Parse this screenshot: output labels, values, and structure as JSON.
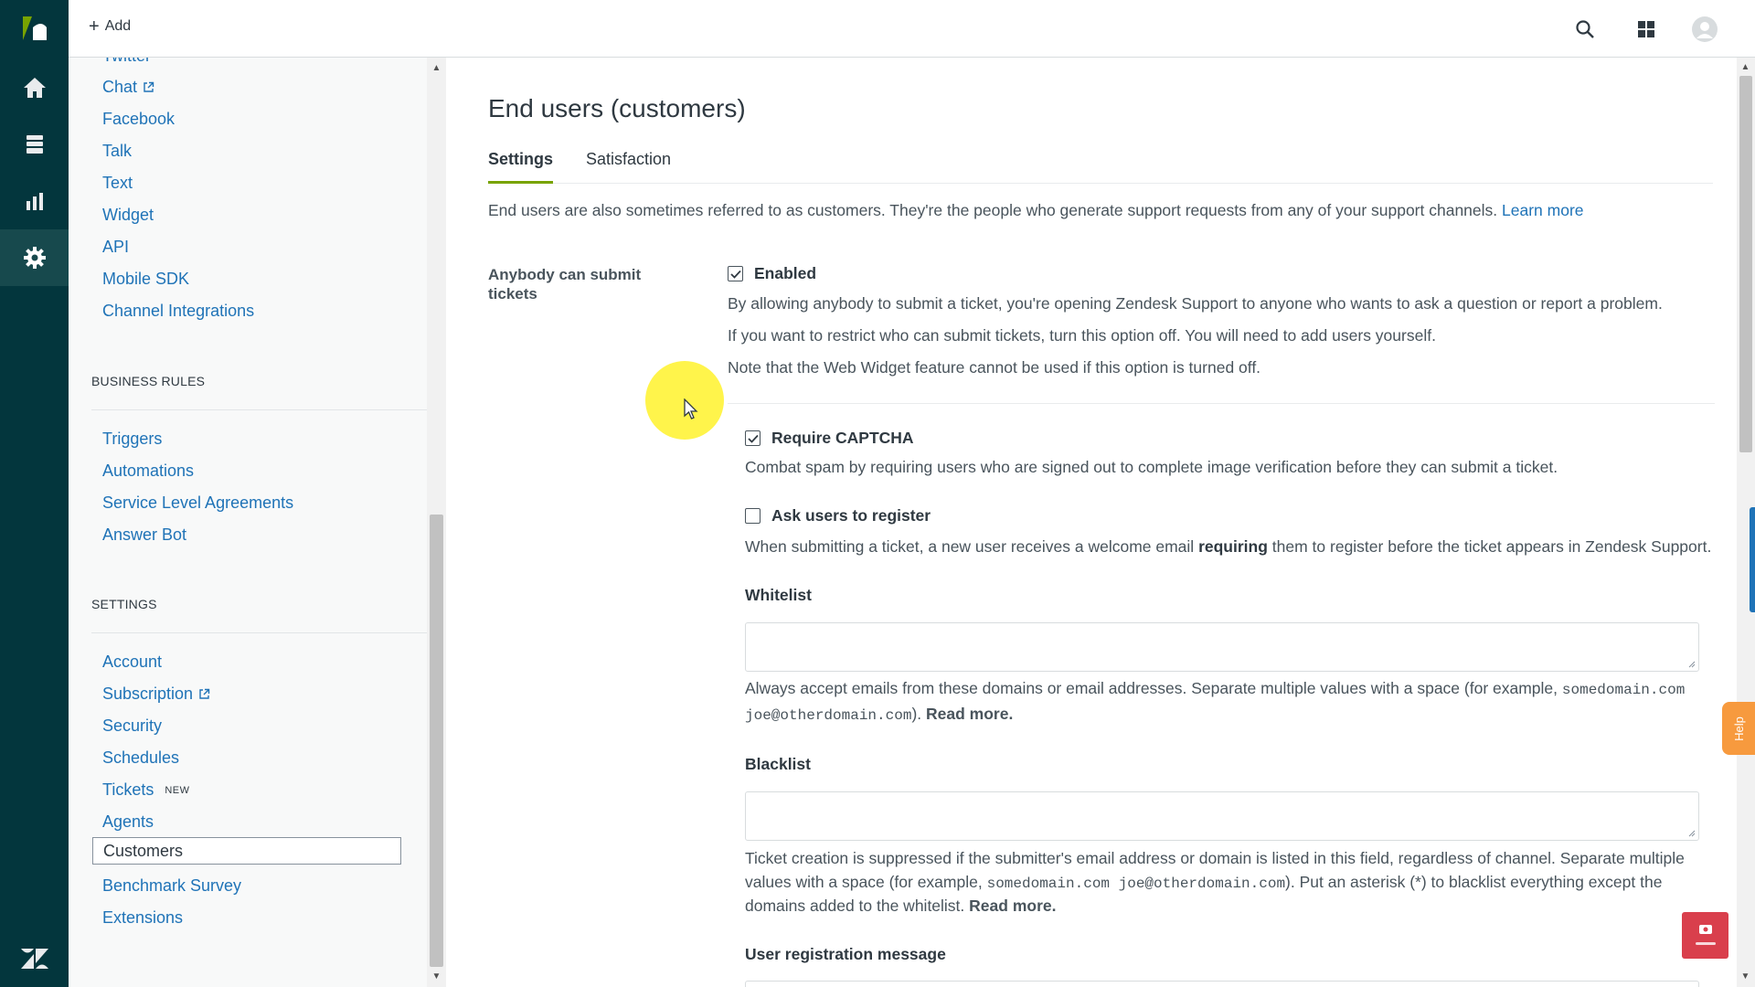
{
  "topbar": {
    "add_label": "Add"
  },
  "sidebar": {
    "cut_item": "Twitter",
    "channels": [
      {
        "label": "Chat",
        "external": true
      },
      {
        "label": "Facebook"
      },
      {
        "label": "Talk"
      },
      {
        "label": "Text"
      },
      {
        "label": "Widget"
      },
      {
        "label": "API"
      },
      {
        "label": "Mobile SDK"
      },
      {
        "label": "Channel Integrations"
      }
    ],
    "business_rules_title": "BUSINESS RULES",
    "business_rules": [
      "Triggers",
      "Automations",
      "Service Level Agreements",
      "Answer Bot"
    ],
    "settings_title": "SETTINGS",
    "settings": [
      "Account",
      "Subscription",
      "Security",
      "Schedules",
      "Tickets",
      "Agents",
      "Customers",
      "Benchmark Survey",
      "Extensions"
    ],
    "new_badge": "NEW"
  },
  "main": {
    "title": "End users (customers)",
    "tabs": [
      "Settings",
      "Satisfaction"
    ],
    "intro": "End users are also sometimes referred to as customers. They're the people who generate support requests from any of your support channels.",
    "intro_link": "Learn more",
    "anybody_label": "Anybody can submit tickets",
    "enabled_label": "Enabled",
    "enabled_desc": [
      "By allowing anybody to submit a ticket, you're opening Zendesk Support to anyone who wants to ask a question or report a problem.",
      "If you want to restrict who can submit tickets, turn this option off. You will need to add users yourself.",
      "Note that the Web Widget feature cannot be used if this option is turned off."
    ],
    "captcha_label": "Require CAPTCHA",
    "captcha_desc": "Combat spam by requiring users who are signed out to complete image verification before they can submit a ticket.",
    "register_label": "Ask users to register",
    "register_desc_1": "When submitting a ticket, a new user receives a welcome email",
    "register_desc_bold": "requiring",
    "register_desc_2": "them to register before the ticket appears in Zendesk Support.",
    "whitelist_label": "Whitelist",
    "whitelist_desc_1": "Always accept emails from these domains or email addresses. Separate multiple values with a space (for example,",
    "whitelist_mono_1": "somedomain.com",
    "whitelist_mono_2": "joe@otherdomain.com",
    "whitelist_desc_2": ").",
    "read_more": "Read more.",
    "blacklist_label": "Blacklist",
    "blacklist_desc_1": "Ticket creation is suppressed if the submitter's email address or domain is listed in this field, regardless of channel. Separate multiple",
    "blacklist_desc_2": "values with a space (for example,",
    "blacklist_mono": "somedomain.com joe@otherdomain.com",
    "blacklist_desc_3": "). Put an asterisk (*) to blacklist everything except the",
    "blacklist_desc_4": "domains added to the whitelist.",
    "user_reg_label": "User registration message"
  },
  "widgets": {
    "help_label": "Help"
  },
  "state": {
    "enabled_checked": true,
    "captcha_checked": true,
    "register_checked": false,
    "whitelist_value": "",
    "blacklist_value": ""
  },
  "colors": {
    "rail": "#03363d",
    "link": "#1f73b7",
    "tab_underline": "#78a300"
  }
}
